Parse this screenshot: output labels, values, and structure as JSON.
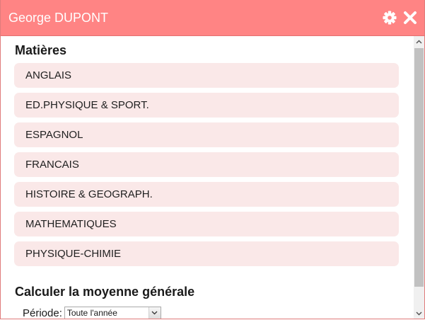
{
  "window": {
    "title": "George DUPONT",
    "icons": [
      "gear-icon",
      "close-icon"
    ],
    "accent_color": "#ff8484",
    "item_background": "#fae8e8"
  },
  "subjects_section": {
    "title": "Matières",
    "items": [
      {
        "label": "ANGLAIS"
      },
      {
        "label": "ED.PHYSIQUE & SPORT."
      },
      {
        "label": "ESPAGNOL"
      },
      {
        "label": "FRANCAIS"
      },
      {
        "label": "HISTOIRE & GEOGRAPH."
      },
      {
        "label": "MATHEMATIQUES"
      },
      {
        "label": "PHYSIQUE-CHIMIE"
      }
    ]
  },
  "average_section": {
    "title": "Calculer la moyenne générale",
    "period_label": "Période:",
    "period_selected": "Toute l'année"
  }
}
